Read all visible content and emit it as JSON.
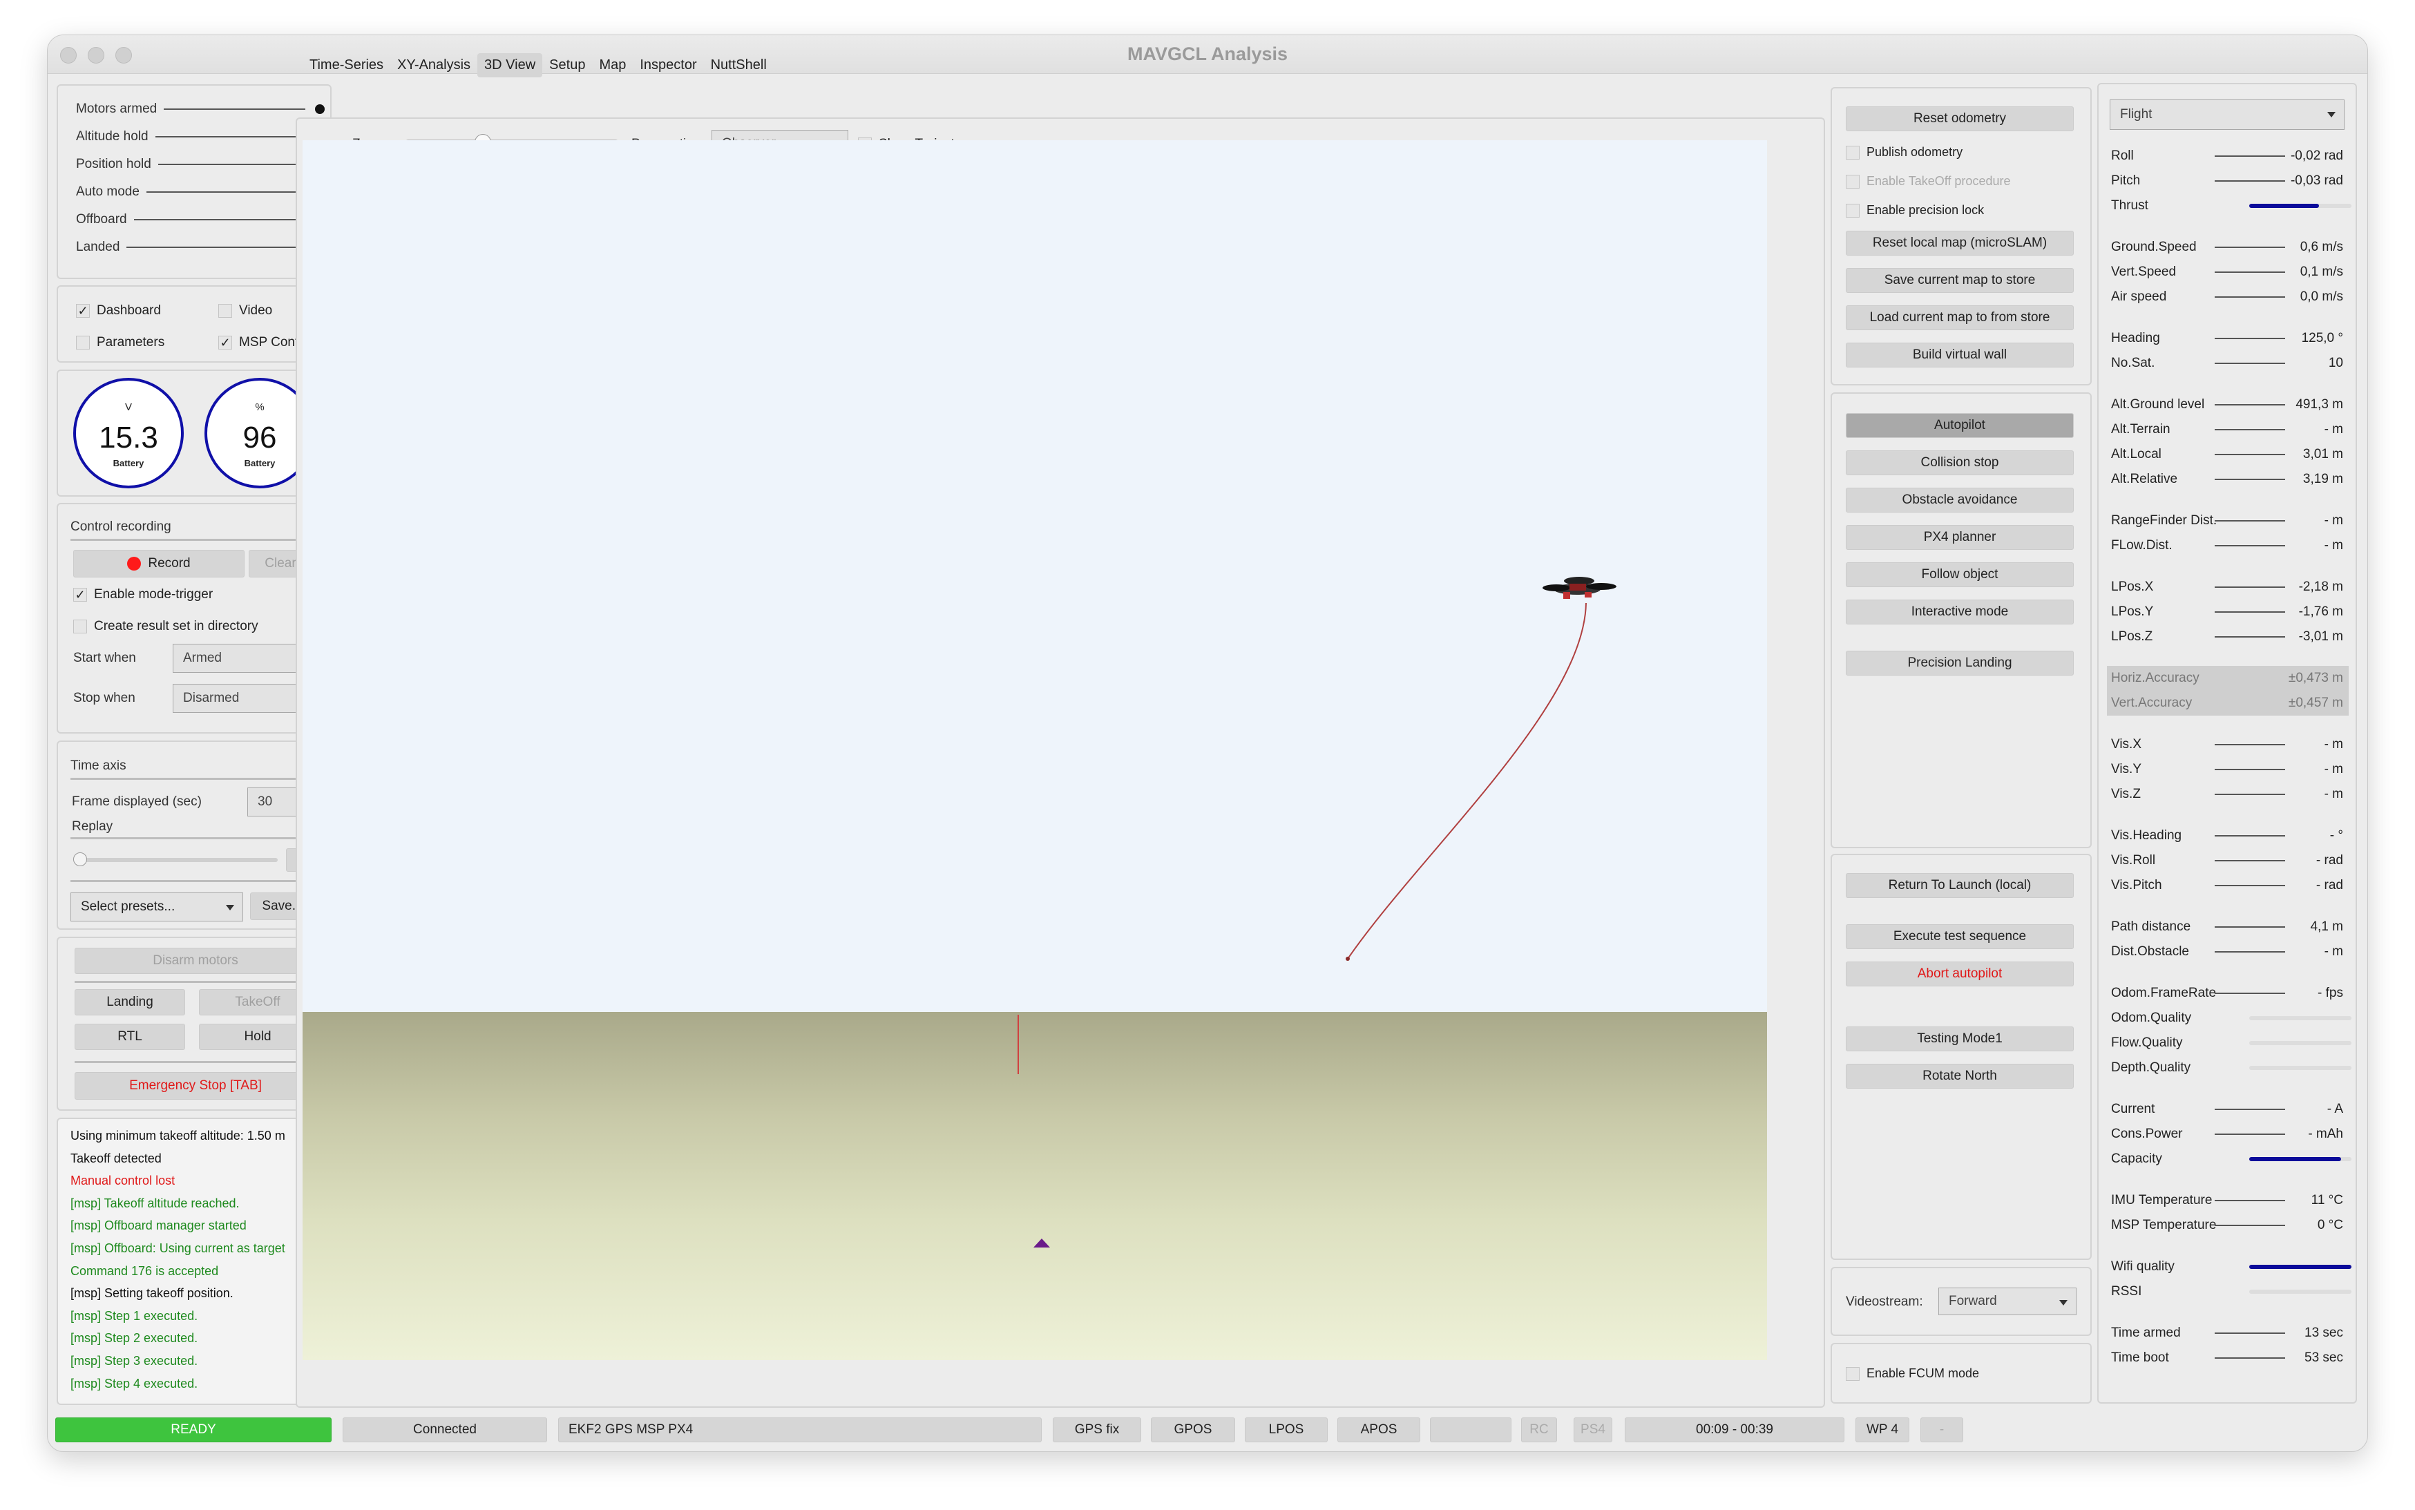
{
  "window": {
    "title": "MAVGCL Analysis"
  },
  "indicators": [
    {
      "label": "Motors armed",
      "on": true
    },
    {
      "label": "Altitude hold",
      "on": false
    },
    {
      "label": "Position hold",
      "on": false
    },
    {
      "label": "Auto mode",
      "on": false
    },
    {
      "label": "Offboard",
      "on": true
    },
    {
      "label": "Landed",
      "on": false
    }
  ],
  "views": {
    "dashboard": "Dashboard",
    "video": "Video",
    "parameters": "Parameters",
    "msp_control": "MSP Control"
  },
  "gauges": [
    {
      "unit": "V",
      "value": "15.3",
      "caption": "Battery"
    },
    {
      "unit": "%",
      "value": "96",
      "caption": "Battery"
    }
  ],
  "recording": {
    "title": "Control recording",
    "record": "Record",
    "clear": "Clear",
    "mode_trigger": "Enable mode-trigger",
    "result_set": "Create result set in directory",
    "start_when_label": "Start when",
    "start_when": "Armed",
    "stop_when_label": "Stop when",
    "stop_when": "Disarmed"
  },
  "time_axis": {
    "title": "Time axis",
    "frame_label": "Frame displayed (sec)",
    "frame_value": "30",
    "replay": "Replay",
    "presets": "Select presets...",
    "save": "Save..."
  },
  "commands": {
    "disarm": "Disarm motors",
    "landing": "Landing",
    "takeoff": "TakeOff",
    "rtl": "RTL",
    "hold": "Hold",
    "emergency": "Emergency Stop [TAB]"
  },
  "log": [
    {
      "text": "Using minimum takeoff altitude: 1.50 m",
      "color": "black"
    },
    {
      "text": "Takeoff detected",
      "color": "black"
    },
    {
      "text": "Manual control lost",
      "color": "red"
    },
    {
      "text": "[msp] Takeoff altitude reached.",
      "color": "green"
    },
    {
      "text": "[msp] Offboard manager started",
      "color": "green"
    },
    {
      "text": "[msp] Offboard: Using current as target",
      "color": "green"
    },
    {
      "text": "Command 176 is accepted",
      "color": "green"
    },
    {
      "text": "[msp] Setting takeoff position.",
      "color": "black"
    },
    {
      "text": "[msp] Step 1 executed.",
      "color": "green"
    },
    {
      "text": "[msp] Step 2 executed.",
      "color": "green"
    },
    {
      "text": "[msp] Step 3 executed.",
      "color": "green"
    },
    {
      "text": "[msp] Step 4 executed.",
      "color": "green"
    }
  ],
  "tabs": [
    "Time-Series",
    "XY-Analysis",
    "3D View",
    "Setup",
    "Map",
    "Inspector",
    "NuttShell"
  ],
  "active_tab": "3D View",
  "view3d": {
    "zoom_label": "Zoom:",
    "perspective_label": "Perspective:",
    "perspective": "Observer",
    "show_trajectory": "Show Trajectory",
    "zoom_level": 0.38
  },
  "msp_top": {
    "reset_odometry": "Reset odometry",
    "publish_odometry": "Publish odometry",
    "enable_takeoff": "Enable TakeOff procedure",
    "precision_lock": "Enable precision lock",
    "reset_local_map": "Reset local map (microSLAM)",
    "save_map": "Save current map to store",
    "load_map": "Load current map to from store",
    "virtual_wall": "Build virtual wall"
  },
  "msp_mid": {
    "autopilot": "Autopilot",
    "collision_stop": "Collision stop",
    "obstacle_avoidance": "Obstacle avoidance",
    "px4_planner": "PX4 planner",
    "follow_object": "Follow object",
    "interactive_mode": "Interactive mode",
    "precision_landing": "Precision Landing"
  },
  "msp_bottom": {
    "rtl_local": "Return To Launch (local)",
    "test_sequence": "Execute test sequence",
    "abort": "Abort autopilot",
    "testing_mode": "Testing Mode1",
    "rotate_north": "Rotate North"
  },
  "videostream": {
    "label": "Videostream:",
    "value": "Forward"
  },
  "fcum": "Enable FCUM mode",
  "flight_select": "Flight",
  "telemetry": [
    {
      "k": "Roll",
      "v": "-0,02 rad"
    },
    {
      "k": "Pitch",
      "v": "-0,03 rad"
    },
    {
      "k": "Thrust",
      "bar": 0.68
    },
    {
      "gap": true
    },
    {
      "k": "Ground.Speed",
      "v": "0,6 m/s"
    },
    {
      "k": "Vert.Speed",
      "v": "0,1 m/s"
    },
    {
      "k": "Air speed",
      "v": "0,0 m/s"
    },
    {
      "gap": true
    },
    {
      "k": "Heading",
      "v": "125,0 °"
    },
    {
      "k": "No.Sat.",
      "v": "10"
    },
    {
      "gap": true
    },
    {
      "k": "Alt.Ground level",
      "v": "491,3 m"
    },
    {
      "k": "Alt.Terrain",
      "v": "- m"
    },
    {
      "k": "Alt.Local",
      "v": "3,01 m"
    },
    {
      "k": "Alt.Relative",
      "v": "3,19 m"
    },
    {
      "gap": true
    },
    {
      "k": "RangeFinder Dist.",
      "v": "- m"
    },
    {
      "k": "FLow.Dist.",
      "v": "- m"
    },
    {
      "gap": true
    },
    {
      "k": "LPos.X",
      "v": "-2,18 m"
    },
    {
      "k": "LPos.Y",
      "v": "-1,76 m"
    },
    {
      "k": "LPos.Z",
      "v": "-3,01 m"
    },
    {
      "gap": true
    },
    {
      "k": "Horiz.Accuracy",
      "v": "±0,473 m",
      "hl": true
    },
    {
      "k": "Vert.Accuracy",
      "v": "±0,457 m",
      "hl": true
    },
    {
      "gap": true
    },
    {
      "k": "Vis.X",
      "v": "- m"
    },
    {
      "k": "Vis.Y",
      "v": "- m"
    },
    {
      "k": "Vis.Z",
      "v": "- m"
    },
    {
      "gap": true
    },
    {
      "k": "Vis.Heading",
      "v": "- °"
    },
    {
      "k": "Vis.Roll",
      "v": "- rad"
    },
    {
      "k": "Vis.Pitch",
      "v": "- rad"
    },
    {
      "gap": true
    },
    {
      "k": "Path distance",
      "v": "4,1 m"
    },
    {
      "k": "Dist.Obstacle",
      "v": "- m"
    },
    {
      "gap": true
    },
    {
      "k": "Odom.FrameRate",
      "v": "- fps"
    },
    {
      "k": "Odom.Quality",
      "bar": 0.0
    },
    {
      "k": "Flow.Quality",
      "bar": 0.0
    },
    {
      "k": "Depth.Quality",
      "bar": 0.0
    },
    {
      "gap": true
    },
    {
      "k": "Current",
      "v": "- A"
    },
    {
      "k": "Cons.Power",
      "v": "- mAh"
    },
    {
      "k": "Capacity",
      "bar": 0.9
    },
    {
      "gap": true
    },
    {
      "k": "IMU Temperature",
      "v": "11 °C"
    },
    {
      "k": "MSP Temperature",
      "v": "0 °C"
    },
    {
      "gap": true
    },
    {
      "k": "Wifi quality",
      "bar": 1.0
    },
    {
      "k": "RSSI",
      "bar": 0.0
    },
    {
      "gap": true
    },
    {
      "k": "Time armed",
      "v": "13 sec"
    },
    {
      "k": "Time boot",
      "v": "53 sec"
    }
  ],
  "statusbar": {
    "ready": "READY",
    "connected": "Connected",
    "system": "EKF2 GPS MSP PX4",
    "gps_fix": "GPS fix",
    "gpos": "GPOS",
    "lpos": "LPOS",
    "apos": "APOS",
    "rc": "RC",
    "ps4": "PS4",
    "time": "00:09 - 00:39",
    "wp": "WP 4",
    "dash": "-"
  },
  "colors": {
    "ready": "#3ec43e",
    "gauge": "#1010a8",
    "record_dot": "#ff1a1a",
    "bar": "#0b0b9a",
    "trajectory": "#b04040"
  }
}
